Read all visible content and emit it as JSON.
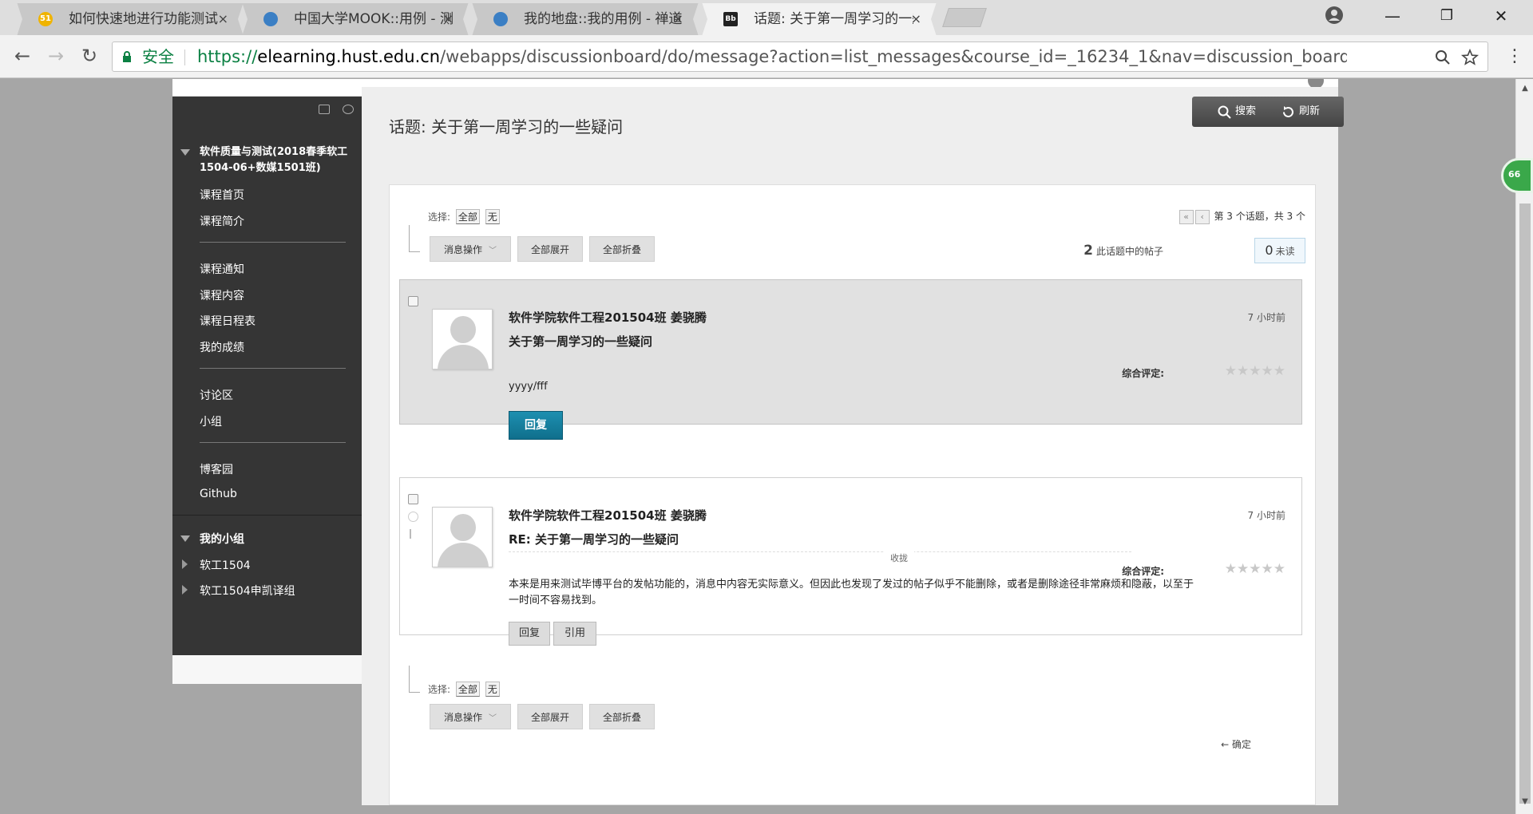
{
  "browser": {
    "tabs": [
      {
        "title": "如何快速地进行功能测试",
        "favicon": "51",
        "favicon_color": "#f0b400"
      },
      {
        "title": "中国大学MOOK::用例 - 测",
        "favicon": "globe",
        "favicon_color": "#3b7fc4"
      },
      {
        "title": "我的地盘::我的用例 - 禅道",
        "favicon": "globe",
        "favicon_color": "#3b7fc4"
      },
      {
        "title": "话题: 关于第一周学习的一些",
        "favicon": "Bb",
        "favicon_color": "#222222"
      }
    ],
    "tab_close_glyph": "×",
    "window_controls": [
      "—",
      "❐",
      "✕"
    ],
    "nav": {
      "back": "←",
      "forward": "→",
      "reload": "↻"
    },
    "secure_label": "安全",
    "url_scheme": "https://",
    "url_host": "elearning.hust.edu.cn",
    "url_path": "/webapps/discussionboard/do/message?action=list_messages&course_id=_16234_1&nav=discussion_board_entry&conf_i...",
    "omnibox_icons": [
      "zoom-icon",
      "star-icon"
    ],
    "menu_glyph": "⋮"
  },
  "badge": {
    "text": "66"
  },
  "sidebar": {
    "course_title": "软件质量与测试(2018春季软工1504-06+数媒1501班)",
    "group1": [
      "课程首页",
      "课程简介"
    ],
    "group2": [
      "课程通知",
      "课程内容",
      "课程日程表",
      "我的成绩"
    ],
    "group3": [
      "讨论区",
      "小组"
    ],
    "group4": [
      "博客园",
      "Github"
    ],
    "my_groups_title": "我的小组",
    "my_groups": [
      "软工1504",
      "软工1504申凯译组"
    ]
  },
  "content": {
    "page_title": "话题: 关于第一周学习的一些疑问",
    "search_label": "搜索",
    "refresh_label": "刷新",
    "select_label": "选择:",
    "select_all": "全部",
    "select_none": "无",
    "msg_action_label": "消息操作",
    "expand_all": "全部展开",
    "collapse_all": "全部折叠",
    "pager_text": "第 3 个话题，共 3 个",
    "post_count_num": "2",
    "post_count_text": "此话题中的帖子",
    "unread_num": "0",
    "unread_text": "未读",
    "confirm_label": "← 确定",
    "messages": [
      {
        "author": "软件学院软件工程201504班 姜骁腾",
        "subject": "关于第一周学习的一些疑问",
        "time": "7 小时前",
        "rating_label": "综合评定:",
        "rating": 0,
        "body": "yyyy/fff",
        "reply_label": "回复"
      },
      {
        "author": "软件学院软件工程201504班 姜骁腾",
        "subject": "RE: 关于第一周学习的一些疑问",
        "time": "7 小时前",
        "collapse_label": "收拢",
        "rating_label": "综合评定:",
        "rating": 0,
        "body_line1": "本来是用来测试毕博平台的发帖功能的，消息中内容无实际意义。但因此也发现了发过的帖子似乎不能删除，或者是删除途径非常麻烦和隐蔽，以至于",
        "body_line2": "一时间不容易找到。",
        "reply_label": "回复",
        "quote_label": "引用"
      }
    ]
  }
}
